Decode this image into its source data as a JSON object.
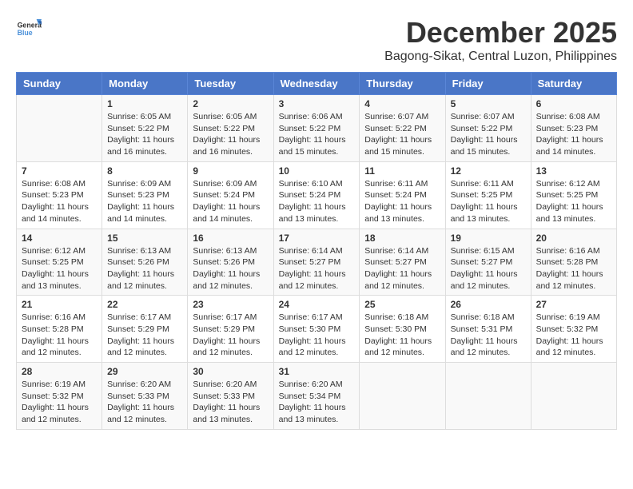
{
  "header": {
    "logo": {
      "line1": "General",
      "line2": "Blue"
    },
    "month": "December 2025",
    "location": "Bagong-Sikat, Central Luzon, Philippines"
  },
  "weekdays": [
    "Sunday",
    "Monday",
    "Tuesday",
    "Wednesday",
    "Thursday",
    "Friday",
    "Saturday"
  ],
  "weeks": [
    [
      {
        "day": "",
        "sunrise": "",
        "sunset": "",
        "daylight": ""
      },
      {
        "day": "1",
        "sunrise": "Sunrise: 6:05 AM",
        "sunset": "Sunset: 5:22 PM",
        "daylight": "Daylight: 11 hours and 16 minutes."
      },
      {
        "day": "2",
        "sunrise": "Sunrise: 6:05 AM",
        "sunset": "Sunset: 5:22 PM",
        "daylight": "Daylight: 11 hours and 16 minutes."
      },
      {
        "day": "3",
        "sunrise": "Sunrise: 6:06 AM",
        "sunset": "Sunset: 5:22 PM",
        "daylight": "Daylight: 11 hours and 15 minutes."
      },
      {
        "day": "4",
        "sunrise": "Sunrise: 6:07 AM",
        "sunset": "Sunset: 5:22 PM",
        "daylight": "Daylight: 11 hours and 15 minutes."
      },
      {
        "day": "5",
        "sunrise": "Sunrise: 6:07 AM",
        "sunset": "Sunset: 5:22 PM",
        "daylight": "Daylight: 11 hours and 15 minutes."
      },
      {
        "day": "6",
        "sunrise": "Sunrise: 6:08 AM",
        "sunset": "Sunset: 5:23 PM",
        "daylight": "Daylight: 11 hours and 14 minutes."
      }
    ],
    [
      {
        "day": "7",
        "sunrise": "Sunrise: 6:08 AM",
        "sunset": "Sunset: 5:23 PM",
        "daylight": "Daylight: 11 hours and 14 minutes."
      },
      {
        "day": "8",
        "sunrise": "Sunrise: 6:09 AM",
        "sunset": "Sunset: 5:23 PM",
        "daylight": "Daylight: 11 hours and 14 minutes."
      },
      {
        "day": "9",
        "sunrise": "Sunrise: 6:09 AM",
        "sunset": "Sunset: 5:24 PM",
        "daylight": "Daylight: 11 hours and 14 minutes."
      },
      {
        "day": "10",
        "sunrise": "Sunrise: 6:10 AM",
        "sunset": "Sunset: 5:24 PM",
        "daylight": "Daylight: 11 hours and 13 minutes."
      },
      {
        "day": "11",
        "sunrise": "Sunrise: 6:11 AM",
        "sunset": "Sunset: 5:24 PM",
        "daylight": "Daylight: 11 hours and 13 minutes."
      },
      {
        "day": "12",
        "sunrise": "Sunrise: 6:11 AM",
        "sunset": "Sunset: 5:25 PM",
        "daylight": "Daylight: 11 hours and 13 minutes."
      },
      {
        "day": "13",
        "sunrise": "Sunrise: 6:12 AM",
        "sunset": "Sunset: 5:25 PM",
        "daylight": "Daylight: 11 hours and 13 minutes."
      }
    ],
    [
      {
        "day": "14",
        "sunrise": "Sunrise: 6:12 AM",
        "sunset": "Sunset: 5:25 PM",
        "daylight": "Daylight: 11 hours and 13 minutes."
      },
      {
        "day": "15",
        "sunrise": "Sunrise: 6:13 AM",
        "sunset": "Sunset: 5:26 PM",
        "daylight": "Daylight: 11 hours and 12 minutes."
      },
      {
        "day": "16",
        "sunrise": "Sunrise: 6:13 AM",
        "sunset": "Sunset: 5:26 PM",
        "daylight": "Daylight: 11 hours and 12 minutes."
      },
      {
        "day": "17",
        "sunrise": "Sunrise: 6:14 AM",
        "sunset": "Sunset: 5:27 PM",
        "daylight": "Daylight: 11 hours and 12 minutes."
      },
      {
        "day": "18",
        "sunrise": "Sunrise: 6:14 AM",
        "sunset": "Sunset: 5:27 PM",
        "daylight": "Daylight: 11 hours and 12 minutes."
      },
      {
        "day": "19",
        "sunrise": "Sunrise: 6:15 AM",
        "sunset": "Sunset: 5:27 PM",
        "daylight": "Daylight: 11 hours and 12 minutes."
      },
      {
        "day": "20",
        "sunrise": "Sunrise: 6:16 AM",
        "sunset": "Sunset: 5:28 PM",
        "daylight": "Daylight: 11 hours and 12 minutes."
      }
    ],
    [
      {
        "day": "21",
        "sunrise": "Sunrise: 6:16 AM",
        "sunset": "Sunset: 5:28 PM",
        "daylight": "Daylight: 11 hours and 12 minutes."
      },
      {
        "day": "22",
        "sunrise": "Sunrise: 6:17 AM",
        "sunset": "Sunset: 5:29 PM",
        "daylight": "Daylight: 11 hours and 12 minutes."
      },
      {
        "day": "23",
        "sunrise": "Sunrise: 6:17 AM",
        "sunset": "Sunset: 5:29 PM",
        "daylight": "Daylight: 11 hours and 12 minutes."
      },
      {
        "day": "24",
        "sunrise": "Sunrise: 6:17 AM",
        "sunset": "Sunset: 5:30 PM",
        "daylight": "Daylight: 11 hours and 12 minutes."
      },
      {
        "day": "25",
        "sunrise": "Sunrise: 6:18 AM",
        "sunset": "Sunset: 5:30 PM",
        "daylight": "Daylight: 11 hours and 12 minutes."
      },
      {
        "day": "26",
        "sunrise": "Sunrise: 6:18 AM",
        "sunset": "Sunset: 5:31 PM",
        "daylight": "Daylight: 11 hours and 12 minutes."
      },
      {
        "day": "27",
        "sunrise": "Sunrise: 6:19 AM",
        "sunset": "Sunset: 5:32 PM",
        "daylight": "Daylight: 11 hours and 12 minutes."
      }
    ],
    [
      {
        "day": "28",
        "sunrise": "Sunrise: 6:19 AM",
        "sunset": "Sunset: 5:32 PM",
        "daylight": "Daylight: 11 hours and 12 minutes."
      },
      {
        "day": "29",
        "sunrise": "Sunrise: 6:20 AM",
        "sunset": "Sunset: 5:33 PM",
        "daylight": "Daylight: 11 hours and 12 minutes."
      },
      {
        "day": "30",
        "sunrise": "Sunrise: 6:20 AM",
        "sunset": "Sunset: 5:33 PM",
        "daylight": "Daylight: 11 hours and 13 minutes."
      },
      {
        "day": "31",
        "sunrise": "Sunrise: 6:20 AM",
        "sunset": "Sunset: 5:34 PM",
        "daylight": "Daylight: 11 hours and 13 minutes."
      },
      {
        "day": "",
        "sunrise": "",
        "sunset": "",
        "daylight": ""
      },
      {
        "day": "",
        "sunrise": "",
        "sunset": "",
        "daylight": ""
      },
      {
        "day": "",
        "sunrise": "",
        "sunset": "",
        "daylight": ""
      }
    ]
  ]
}
